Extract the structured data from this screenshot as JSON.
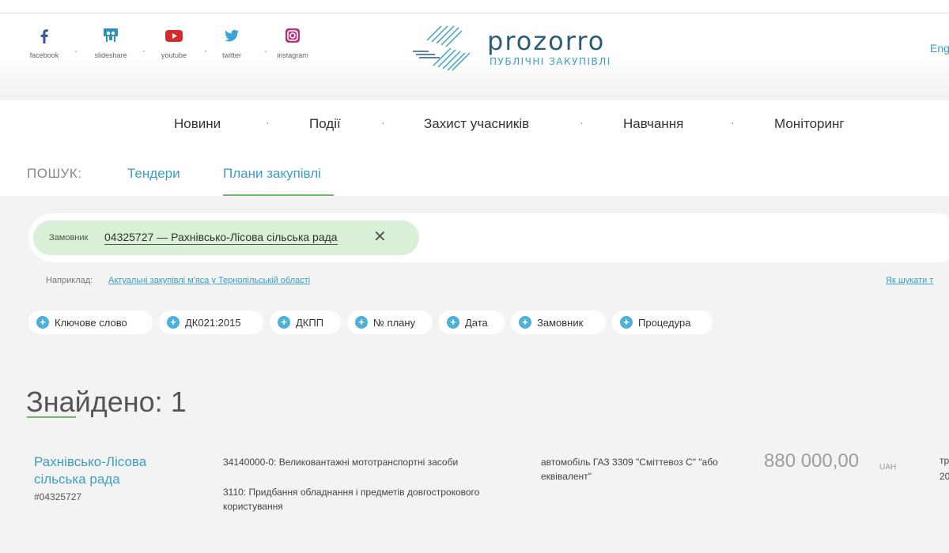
{
  "social": [
    {
      "label": "facebook",
      "icon": "facebook-icon"
    },
    {
      "label": "slideshare",
      "icon": "slideshare-icon"
    },
    {
      "label": "youtube",
      "icon": "youtube-icon"
    },
    {
      "label": "twitter",
      "icon": "twitter-icon"
    },
    {
      "label": "instagram",
      "icon": "instagram-icon"
    }
  ],
  "logo": {
    "word": "prozorro",
    "subtitle": "ПУБЛІЧНІ ЗАКУПІВЛІ"
  },
  "lang_link": "Eng",
  "nav": [
    "Новини",
    "Події",
    "Захист учасників",
    "Навчання",
    "Моніторинг"
  ],
  "search": {
    "label": "ПОШУК:",
    "tabs": [
      "Тендери",
      "Плани закупівлі"
    ],
    "active_tab": "Плани закупівлі"
  },
  "filter_chip": {
    "key": "Замовник",
    "value": "04325727 — Рахнівсько-Лісова сільська рада",
    "close_glyph": "✕"
  },
  "example": {
    "label": "Наприклад:",
    "link": "Актуальні закупівлі м'яса у Тернопільській області",
    "howto": "Як шукати т"
  },
  "filters": [
    "Ключове слово",
    "ДК021:2015",
    "ДКПП",
    "№ плану",
    "Дата",
    "Замовник",
    "Процедура"
  ],
  "found": "Знайдено: 1",
  "result": {
    "buyer": "Рахнівсько-Лісова сільська рада",
    "buyer_id": "#04325727",
    "cpv": "34140000-0: Великовантажні мототранспортні засоби",
    "kekv": "3110: Придбання обладнання і предметів довгострокового користування",
    "description": "автомобіль ГАЗ 3309 \"Сміттевоз С\" \"або еквівалент\"",
    "amount": "880 000,00",
    "currency": "UAH",
    "cut_1": "тр",
    "cut_2": "20"
  },
  "colors": {
    "link": "#3b9ec2",
    "accent_green": "#6db86d",
    "chip_bg": "#d9efd8",
    "plus_bg": "#4db1d6"
  }
}
